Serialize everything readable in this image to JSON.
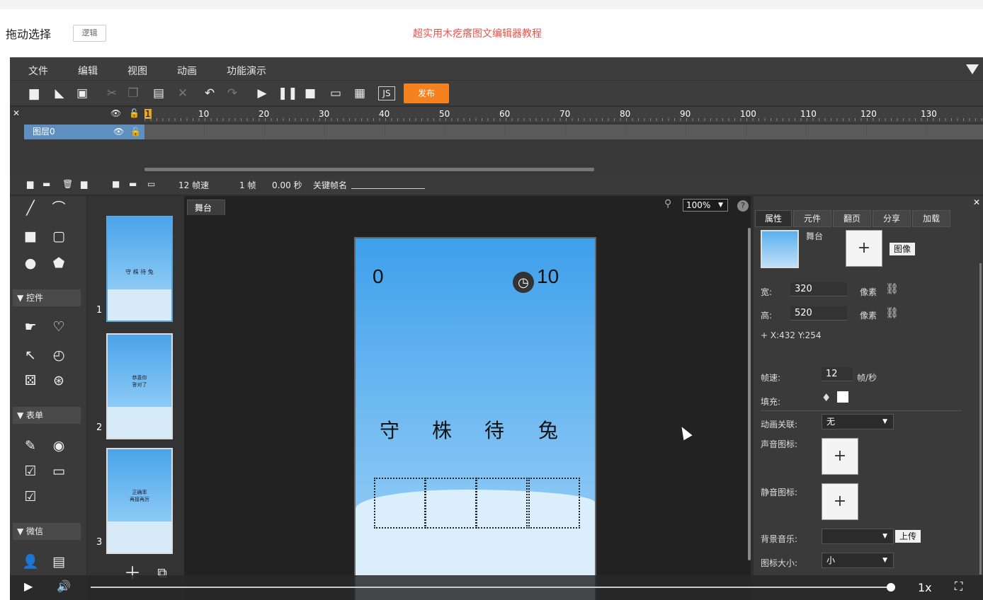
{
  "page": {
    "title": "拖动选择",
    "logic_btn": "逻辑",
    "link": "超实用木疙瘩图文编辑器教程"
  },
  "menu": [
    "文件",
    "编辑",
    "视图",
    "动画",
    "功能演示"
  ],
  "toolbar": {
    "publish": "发布",
    "js": "JS"
  },
  "timeline": {
    "ruler": [
      "1",
      "10",
      "20",
      "30",
      "40",
      "50",
      "60",
      "70",
      "80",
      "90",
      "100",
      "110",
      "120",
      "130"
    ],
    "layer": "图层0",
    "fps": "12 帧速",
    "frame": "1 帧",
    "time": "0.00 秒",
    "keyframe_label": "关键帧名"
  },
  "tools": {
    "sections": [
      "▼ 控件",
      "▼ 表单",
      "▼ 微信"
    ]
  },
  "pages": {
    "nums": [
      "1",
      "2",
      "3"
    ],
    "t1": "守 株 待 兔",
    "t2": "恭喜你\n答对了",
    "t3": "正确率\n再接再厉"
  },
  "stage": {
    "tab": "舞台",
    "zoom": "100%",
    "score": "0",
    "timer": "10",
    "phrase": [
      "守",
      "株",
      "待",
      "兔"
    ]
  },
  "props": {
    "tabs": [
      "属性",
      "元件",
      "翻页",
      "分享",
      "加载"
    ],
    "stage_label": "舞台",
    "image_btn": "图像",
    "width_label": "宽:",
    "width": "320",
    "height_label": "高:",
    "height": "520",
    "unit": "像素",
    "coords": "+  X:432   Y:254",
    "fps_label": "帧速:",
    "fps": "12",
    "fps_unit": "帧/秒",
    "fill_label": "填充:",
    "anim_label": "动画关联:",
    "anim_value": "无",
    "sound_label": "声音图标:",
    "mute_label": "静音图标:",
    "bgm_label": "背景音乐:",
    "upload": "上传",
    "iconsize_label": "图标大小:",
    "iconsize_value": "小"
  },
  "player": {
    "speed": "1x"
  }
}
